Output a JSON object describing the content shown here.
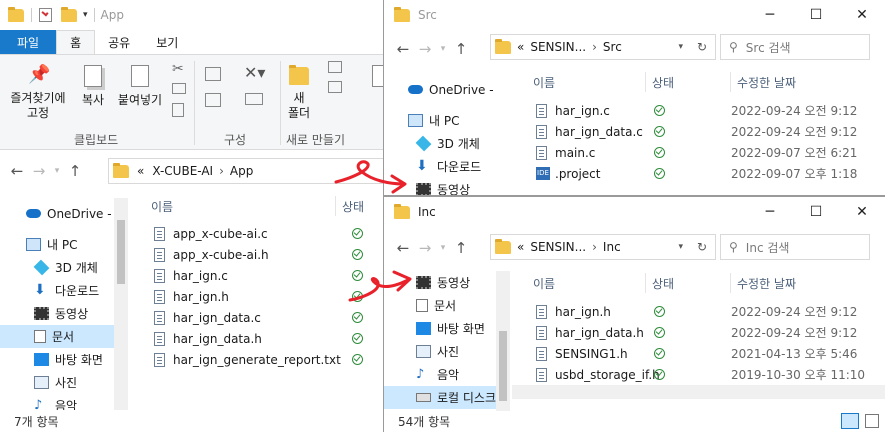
{
  "app_window": {
    "title": "App",
    "ribbon_tabs": [
      "파일",
      "홈",
      "공유",
      "보기"
    ],
    "ribbon_buttons": {
      "pin": "즐겨찾기에\n고정",
      "copy": "복사",
      "paste": "붙여넣기",
      "new_folder": "새\n폴더"
    },
    "ribbon_groups": {
      "clipboard": "클립보드",
      "organize": "구성",
      "new": "새로 만들기"
    },
    "breadcrumb_prefix": "«",
    "breadcrumb": [
      "X-CUBE-AI",
      "App"
    ],
    "nav_items": [
      {
        "label": "OneDrive - F",
        "icon": "onedrive-icon"
      },
      {
        "label": "내 PC",
        "icon": "pc-icon"
      },
      {
        "label": "3D 개체",
        "icon": "3d-objects-icon"
      },
      {
        "label": "다운로드",
        "icon": "download-icon"
      },
      {
        "label": "동영상",
        "icon": "video-icon"
      },
      {
        "label": "문서",
        "icon": "documents-icon",
        "selected": true
      },
      {
        "label": "바탕 화면",
        "icon": "desktop-icon"
      },
      {
        "label": "사진",
        "icon": "pictures-icon"
      },
      {
        "label": "음악",
        "icon": "music-icon"
      }
    ],
    "columns": {
      "name": "이름",
      "status": "상태"
    },
    "files": [
      "app_x-cube-ai.c",
      "app_x-cube-ai.h",
      "har_ign.c",
      "har_ign.h",
      "har_ign_data.c",
      "har_ign_data.h",
      "har_ign_generate_report.txt"
    ],
    "status_text": "7개 항목"
  },
  "src_window": {
    "title": "Src",
    "breadcrumb_prefix": "«",
    "breadcrumb": [
      "SENSIN...",
      "Src"
    ],
    "search_placeholder": "Src 검색",
    "nav_items": [
      {
        "label": "OneDrive - P",
        "icon": "onedrive-icon"
      },
      {
        "label": "내 PC",
        "icon": "pc-icon"
      },
      {
        "label": "3D 개체",
        "icon": "3d-objects-icon"
      },
      {
        "label": "다운로드",
        "icon": "download-icon"
      },
      {
        "label": "동영상",
        "icon": "video-icon"
      }
    ],
    "columns": {
      "name": "이름",
      "status": "상태",
      "modified": "수정한 날짜"
    },
    "files": [
      {
        "name": "har_ign.c",
        "date": "2022-09-24 오전 9:12",
        "icon": "c-file-icon"
      },
      {
        "name": "har_ign_data.c",
        "date": "2022-09-24 오전 9:12",
        "icon": "c-file-icon"
      },
      {
        "name": "main.c",
        "date": "2022-09-07 오전 6:21",
        "icon": "c-file-icon"
      },
      {
        "name": ".project",
        "date": "2022-09-07 오후 1:18",
        "icon": "ide-file-icon"
      }
    ]
  },
  "inc_window": {
    "title": "Inc",
    "breadcrumb_prefix": "«",
    "breadcrumb": [
      "SENSIN...",
      "Inc"
    ],
    "search_placeholder": "Inc 검색",
    "nav_items": [
      {
        "label": "동영상",
        "icon": "video-icon"
      },
      {
        "label": "문서",
        "icon": "documents-icon"
      },
      {
        "label": "바탕 화면",
        "icon": "desktop-icon"
      },
      {
        "label": "사진",
        "icon": "pictures-icon"
      },
      {
        "label": "음악",
        "icon": "music-icon"
      },
      {
        "label": "로컬 디스크",
        "icon": "local-disk-icon",
        "selected": true
      }
    ],
    "columns": {
      "name": "이름",
      "status": "상태",
      "modified": "수정한 날짜"
    },
    "files": [
      {
        "name": "har_ign.h",
        "date": "2022-09-24 오전 9:12"
      },
      {
        "name": "har_ign_data.h",
        "date": "2022-09-24 오전 9:12"
      },
      {
        "name": "SENSING1.h",
        "date": "2021-04-13 오후 5:46"
      },
      {
        "name": "usbd_storage_if.h",
        "date": "2019-10-30 오후 11:10"
      }
    ],
    "status_text": "54개 항목"
  },
  "colors": {
    "accent": "#1979ca",
    "folder": "#f3c64b",
    "status_ok": "#2f8c3c",
    "annotation_arrow": "#e8212a",
    "selection": "#cce8ff"
  }
}
